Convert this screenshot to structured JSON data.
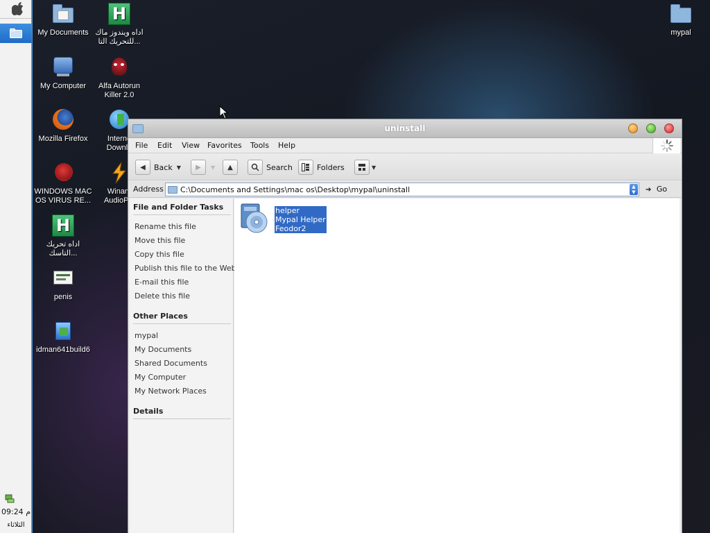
{
  "dock": {
    "clock": "09:24 م",
    "day": "الثلاثاء"
  },
  "desktop": {
    "icons": [
      {
        "label": "My Documents",
        "icon": "my-documents-folder-icon"
      },
      {
        "label": "اداه ويندوز ماك\nللتحريك التا...",
        "icon": "h-app-icon"
      },
      {
        "label": "My Computer",
        "icon": "my-computer-icon"
      },
      {
        "label": "Alfa Autorun\nKiller 2.0",
        "icon": "alfa-autorun-icon"
      },
      {
        "label": "Mozilla Firefox",
        "icon": "firefox-icon"
      },
      {
        "label": "Interne\nDownlo",
        "icon": "internet-download-manager-icon"
      },
      {
        "label": "WINDOWS MAC\nOS VIRUS RE...",
        "icon": "virus-icon"
      },
      {
        "label": "Winam\nAudioPla",
        "icon": "winamp-icon"
      },
      {
        "label": "اداه تحريك\nالتاسك...",
        "icon": "h-app-icon"
      },
      {
        "label": "penis",
        "icon": "document-icon"
      },
      {
        "label": "idman641build6",
        "icon": "installer-icon"
      },
      {
        "label": "mypal",
        "icon": "folder-icon"
      }
    ]
  },
  "window": {
    "title": "uninstall",
    "menu": [
      "File",
      "Edit",
      "View",
      "Favorites",
      "Tools",
      "Help"
    ],
    "toolbar": {
      "back": "Back",
      "search": "Search",
      "folders": "Folders"
    },
    "address": {
      "label": "Address",
      "value": "C:\\Documents and Settings\\mac os\\Desktop\\mypal\\uninstall",
      "go": "Go"
    },
    "tasks": {
      "file_folder_title": "File and Folder Tasks",
      "file_folder_items": [
        "Rename this file",
        "Move this file",
        "Copy this file",
        "Publish this file to the Web",
        "E-mail this file",
        "Delete this file"
      ],
      "other_places_title": "Other Places",
      "other_places_items": [
        "mypal",
        "My Documents",
        "Shared Documents",
        "My Computer",
        "My Network Places"
      ],
      "details_title": "Details"
    },
    "file": {
      "name": "helper",
      "description": "Mypal Helper",
      "company": "Feodor2"
    }
  },
  "colors": {
    "selection": "#316ac5",
    "dock_accent": "#4a8fd0"
  }
}
